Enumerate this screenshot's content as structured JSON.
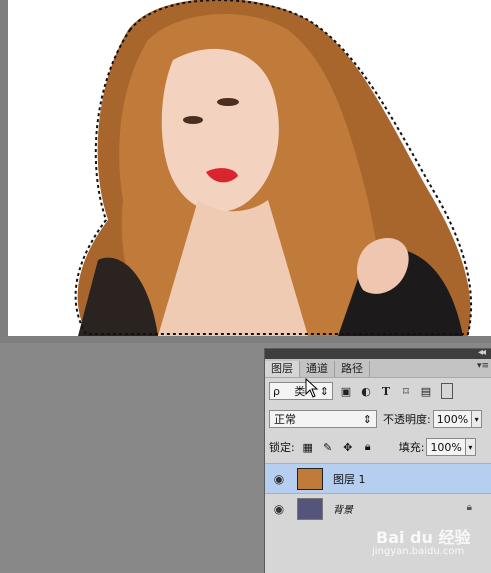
{
  "panel": {
    "tabs": [
      {
        "label": "图层"
      },
      {
        "label": "通道"
      },
      {
        "label": "路径"
      }
    ],
    "filter": {
      "kind_label": "类",
      "search_glyph": "ρ"
    },
    "blend_mode": "正常",
    "opacity_label": "不透明度:",
    "opacity_value": "100%",
    "lock_label": "锁定:",
    "fill_label": "填充:",
    "fill_value": "100%",
    "layers": [
      {
        "name": "图层 1",
        "selected": true
      },
      {
        "name": "背景",
        "locked": true
      }
    ]
  },
  "watermark": {
    "brand": "Bai du 经验",
    "url": "jingyan.baidu.com"
  },
  "colors": {
    "selection": "#b6cff0",
    "background_thumb": "#55547a",
    "hair": "#a8662c"
  }
}
